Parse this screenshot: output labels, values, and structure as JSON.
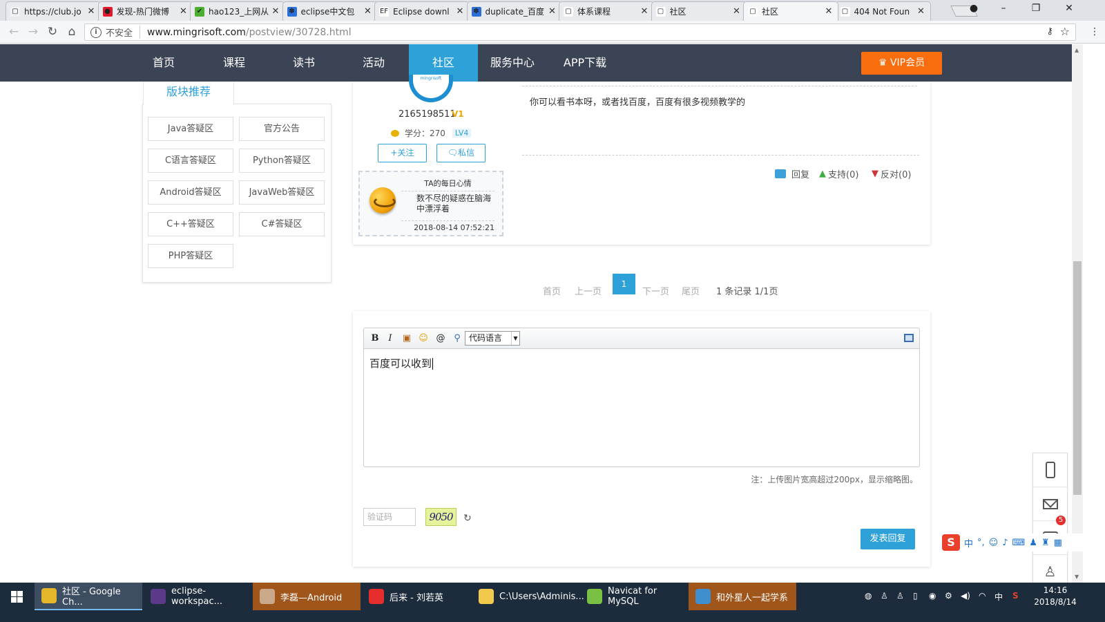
{
  "browser": {
    "tabs": [
      {
        "title": "https://club.jo",
        "icon_color": "#f1f3f4",
        "icon_char": "▢"
      },
      {
        "title": "发现-热门微博",
        "icon_color": "#e6162d",
        "icon_char": "●"
      },
      {
        "title": "hao123_上网从",
        "icon_color": "#4caf2f",
        "icon_char": "✔"
      },
      {
        "title": "eclipse中文包",
        "icon_color": "#2d6fd9",
        "icon_char": "✽"
      },
      {
        "title": "Eclipse downl",
        "icon_color": "#ffffff",
        "icon_char": "EF"
      },
      {
        "title": "duplicate_百度",
        "icon_color": "#2d6fd9",
        "icon_char": "✽"
      },
      {
        "title": "体系课程",
        "icon_color": "#ffffff",
        "icon_char": "▢"
      },
      {
        "title": "社区",
        "icon_color": "#ffffff",
        "icon_char": "▢"
      },
      {
        "title": "社区",
        "icon_color": "#ffffff",
        "icon_char": "▢"
      },
      {
        "title": "404 Not Foun",
        "icon_color": "#ffffff",
        "icon_char": "▢"
      }
    ],
    "active_tab_index": 8,
    "insecure_label": "不安全",
    "url_host": "www.mingrisoft.com",
    "url_path": "/postview/30728.html"
  },
  "site_nav": {
    "items": [
      "首页",
      "课程",
      "读书",
      "活动",
      "社区",
      "服务中心",
      "APP下载"
    ],
    "active_index": 4,
    "vip_label": "VIP会员"
  },
  "board": {
    "title": "版块推荐",
    "items": [
      "Java答疑区",
      "官方公告",
      "C语言答疑区",
      "Python答疑区",
      "Android答疑区",
      "JavaWeb答疑区",
      "C++答疑区",
      "C#答疑区",
      "PHP答疑区"
    ]
  },
  "post": {
    "username": "2165198511",
    "vip_badge": "V1",
    "credits_label": "学分：270",
    "level": "LV4",
    "follow_label": "+关注",
    "message_label": "私信",
    "mood": {
      "title": "TA的每日心情",
      "text": "数不尽的疑惑在脑海中漂浮着",
      "time": "2018-08-14 07:52:21"
    },
    "reply_text": "你可以看书本呀，或者找百度，百度有很多视频教学的",
    "actions": {
      "reply": "回复",
      "support": "支持(0)",
      "oppose": "反对(0)"
    }
  },
  "pagination": {
    "first": "首页",
    "prev": "上一页",
    "current": "1",
    "next": "下一页",
    "last": "尾页",
    "info": "1 条记录 1/1页"
  },
  "editor": {
    "code_lang_label": "代码语言",
    "content": "百度可以收到",
    "notice": "注：上传图片宽高超过200px，显示缩略图。",
    "captcha_placeholder": "验证码",
    "captcha_text": "9050",
    "submit_label": "发表回复"
  },
  "side_toolbar": {
    "message_badge": "5"
  },
  "ime": {
    "label": "中"
  },
  "taskbar": {
    "tasks": [
      {
        "label": "社区 - Google Ch...",
        "icon_color": "#e4b629"
      },
      {
        "label": "eclipse-workspac...",
        "icon_color": "#5b3a8a"
      },
      {
        "label": "李磊—Android",
        "icon_color": "#c9a98a"
      },
      {
        "label": "后来 - 刘若英",
        "icon_color": "#e62e2e"
      },
      {
        "label": "C:\\Users\\Adminis...",
        "icon_color": "#f2c94c"
      },
      {
        "label": "Navicat for MySQL",
        "icon_color": "#7ac143"
      },
      {
        "label": "和外星人一起学系",
        "icon_color": "#3e8ed0"
      }
    ],
    "tray_input": "中",
    "time": "14:16",
    "date": "2018/8/14"
  }
}
